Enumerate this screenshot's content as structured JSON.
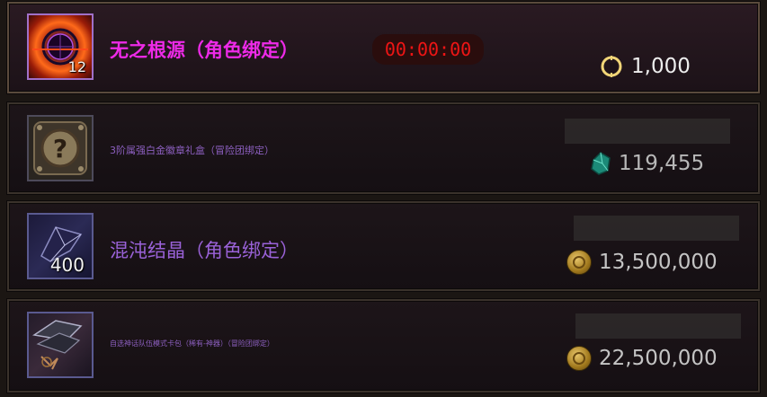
{
  "items": [
    {
      "name": "无之根源（角色绑定）",
      "icon": "purple-orb-icon",
      "count": "12",
      "timer": "00:00:00",
      "price": "1,000",
      "currency_icon": "cera-point-icon",
      "name_color": "#ee2ae8"
    },
    {
      "name": "3阶属强白金徽章礼盒（冒险团绑定）",
      "icon": "mystery-box-icon",
      "count": "",
      "price": "119,455",
      "currency_icon": "green-gem-icon"
    },
    {
      "name": "混沌结晶（角色绑定）",
      "icon": "dark-crystal-icon",
      "count": "400",
      "price": "13,500,000",
      "currency_icon": "gold-coin-icon"
    },
    {
      "name": "自选神话队伍模式卡包（稀有-神器）（冒险团绑定）",
      "icon": "card-pack-icon",
      "count": "",
      "price": "22,500,000",
      "currency_icon": "gold-coin-icon"
    }
  ],
  "colors": {
    "timer_red": "#ee1515",
    "item_purple": "#9a62d8",
    "highlight_magenta": "#ee2ae8"
  }
}
